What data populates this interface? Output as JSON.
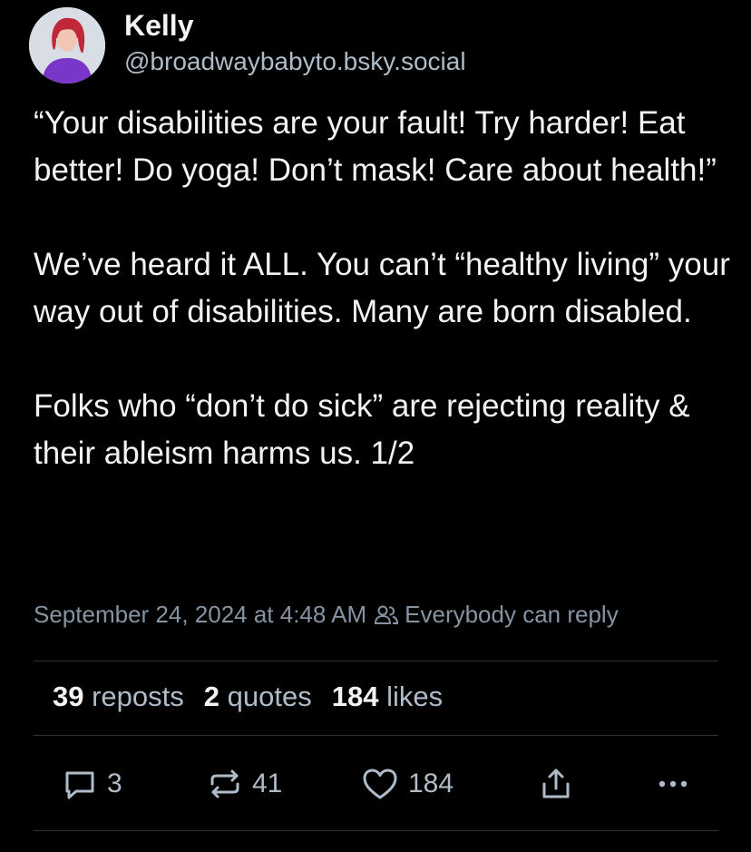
{
  "author": {
    "display_name": "Kelly",
    "handle": "@broadwaybabyto.bsky.social"
  },
  "post": {
    "paragraphs": [
      "“Your disabilities are your fault! Try harder! Eat better! Do yoga! Don’t mask! Care about health!”",
      "We’ve heard it ALL. You can’t “healthy living” your way out of disabilities. Many are born disabled.",
      "Folks who “don’t do sick” are rejecting reality & their ableism harms us. 1/2"
    ],
    "timestamp": "September 24, 2024 at 4:48 AM",
    "reply_setting": "Everybody can reply"
  },
  "stats": {
    "reposts_count": "39",
    "reposts_label": "reposts",
    "quotes_count": "2",
    "quotes_label": "quotes",
    "likes_count": "184",
    "likes_label": "likes"
  },
  "actions": {
    "reply_count": "3",
    "repost_count": "41",
    "like_count": "184"
  },
  "icons": {
    "reply": "speech-bubble-icon",
    "repost": "repost-arrows-icon",
    "like": "heart-icon",
    "share": "share-icon",
    "more": "ellipsis-icon",
    "reply_setting": "people-icon"
  },
  "colors": {
    "background": "#000000",
    "primary_text": "#f1f3f5",
    "secondary_text": "#aebbc9",
    "meta_text": "#8593a3",
    "divider": "#2a323d"
  }
}
